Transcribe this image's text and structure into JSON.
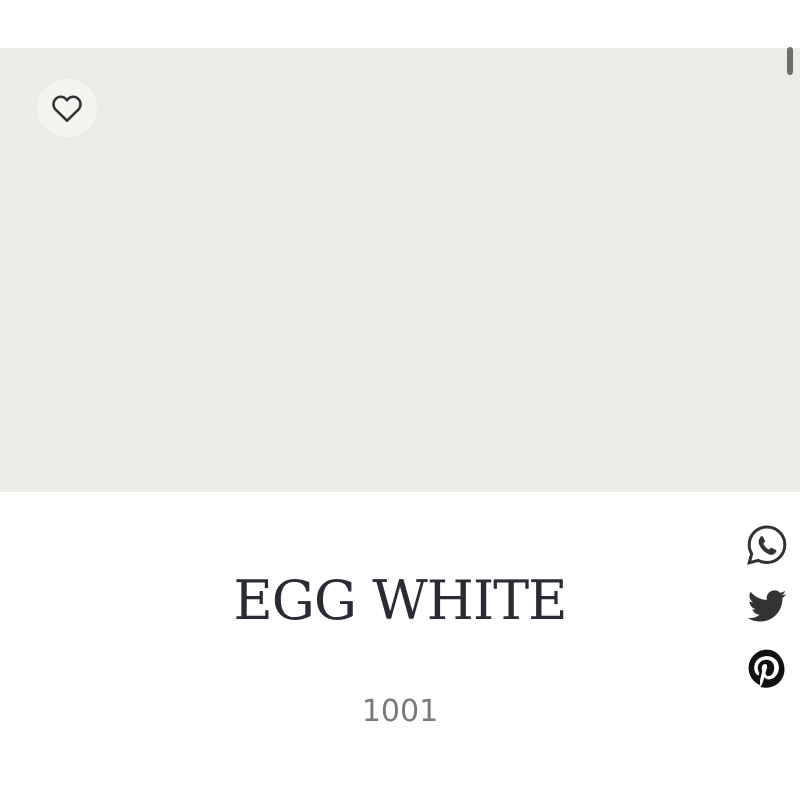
{
  "color": {
    "name": "EGG WHITE",
    "code": "1001",
    "swatch_hex": "#ecebe5"
  },
  "icons": {
    "favorite": "heart-outline-icon",
    "share": [
      "whatsapp-icon",
      "twitter-icon",
      "pinterest-icon"
    ]
  },
  "colors": {
    "title": "#2b2b35",
    "code": "#7b7b7b",
    "icon": "#333333",
    "fav_background": "#f5f4f0"
  }
}
